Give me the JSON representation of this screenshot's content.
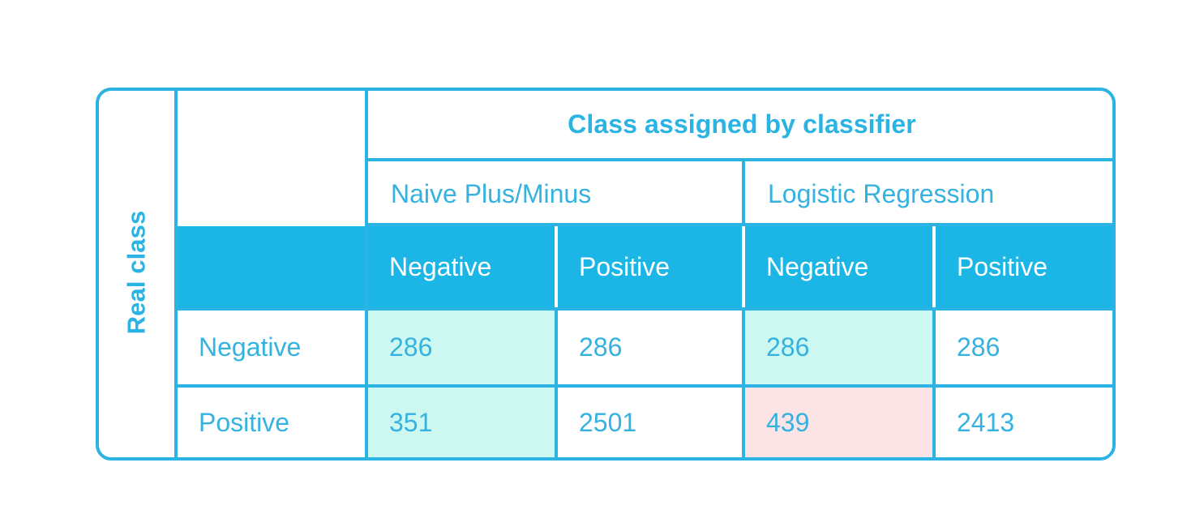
{
  "figure": {
    "row_axis_label": "Real class",
    "column_axis_title": "Class assigned by classifier"
  },
  "chart_data": {
    "type": "table",
    "title": "Class assigned by classifier",
    "row_axis_label": "Real class",
    "column_groups": [
      {
        "label": "Naive Plus/Minus",
        "columns": [
          "Negative",
          "Positive"
        ]
      },
      {
        "label": "Logistic Regression",
        "columns": [
          "Negative",
          "Positive"
        ]
      }
    ],
    "column_headers": [
      "Negative",
      "Positive",
      "Negative",
      "Positive"
    ],
    "row_headers": [
      "Negative",
      "Positive"
    ],
    "rows": [
      {
        "label": "Negative",
        "cells": [
          {
            "value": "286",
            "highlight": "mint"
          },
          {
            "value": "286",
            "highlight": "none"
          },
          {
            "value": "286",
            "highlight": "mint"
          },
          {
            "value": "286",
            "highlight": "none"
          }
        ]
      },
      {
        "label": "Positive",
        "cells": [
          {
            "value": "351",
            "highlight": "mint"
          },
          {
            "value": "2501",
            "highlight": "none"
          },
          {
            "value": "439",
            "highlight": "pink"
          },
          {
            "value": "2413",
            "highlight": "none"
          }
        ]
      }
    ],
    "values": [
      [
        286,
        286,
        286,
        286
      ],
      [
        351,
        2501,
        439,
        2413
      ]
    ],
    "colors": {
      "accent": "#2BB4E3",
      "header_fill": "#1CB6E6",
      "header_text": "#ffffff",
      "body_text": "#35B2E0",
      "highlight_mint": "#CDF7F1",
      "highlight_pink": "#FCE4E6",
      "background": "#ffffff"
    }
  }
}
